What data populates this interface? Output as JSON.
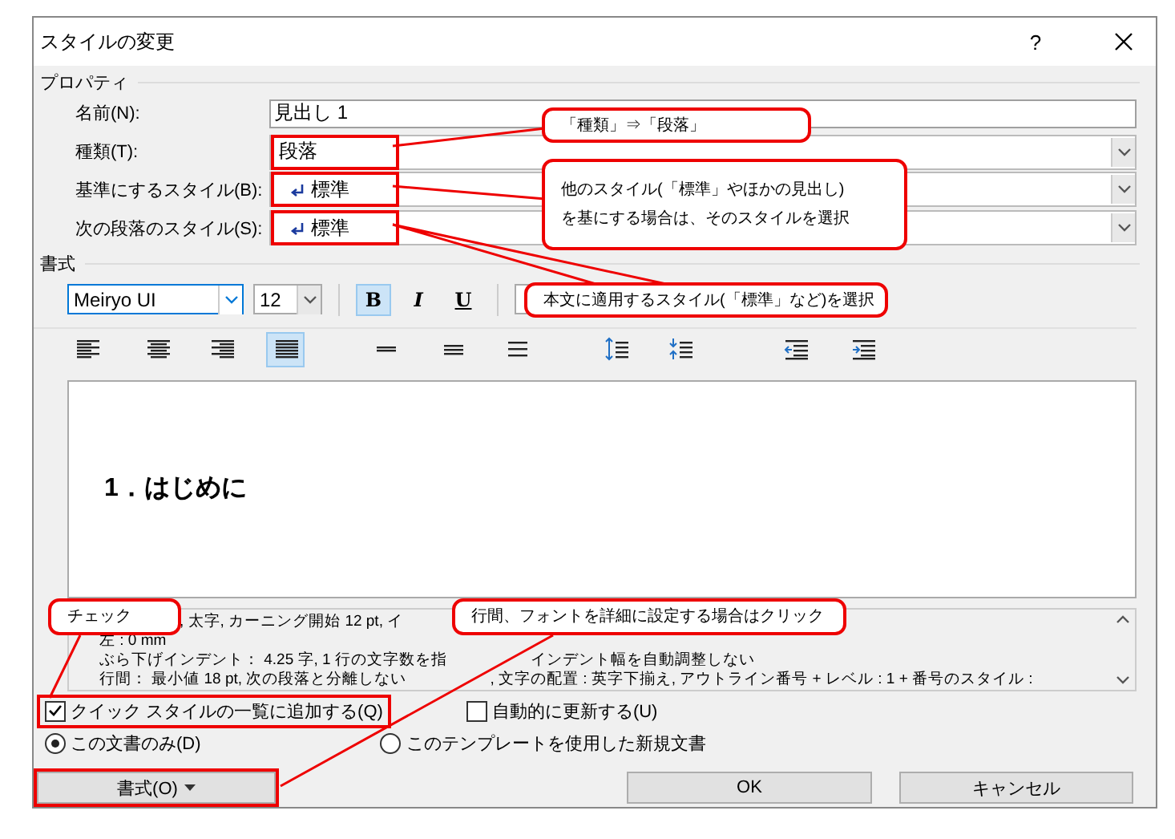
{
  "window": {
    "title": "スタイルの変更",
    "help": "?"
  },
  "properties": {
    "heading": "プロパティ",
    "fields": [
      {
        "label": "名前(N):",
        "value": "見出し 1",
        "kind": "text",
        "highlighted": false
      },
      {
        "label": "種類(T):",
        "value": "段落",
        "kind": "select",
        "highlighted": true
      },
      {
        "label": "基準にするスタイル(B):",
        "value": "標準",
        "kind": "style-select",
        "highlighted": true
      },
      {
        "label": "次の段落のスタイル(S):",
        "value": "標準",
        "kind": "style-select",
        "highlighted": true
      }
    ]
  },
  "format": {
    "heading": "書式",
    "font": "Meiryo UI",
    "size": "12",
    "styles": [
      {
        "label": "B",
        "kind": "bold",
        "selected": true
      },
      {
        "label": "I",
        "kind": "italic",
        "selected": false
      },
      {
        "label": "U",
        "kind": "underline",
        "selected": false
      }
    ],
    "paragraph_tools": [
      {
        "kind": "align-left",
        "selected": false
      },
      {
        "kind": "align-center",
        "selected": false
      },
      {
        "kind": "align-right",
        "selected": false
      },
      {
        "kind": "justify",
        "selected": true
      },
      {
        "kind": "single",
        "selected": false
      },
      {
        "kind": "one-half",
        "selected": false
      },
      {
        "kind": "double",
        "selected": false
      },
      {
        "kind": "space-more",
        "selected": false
      },
      {
        "kind": "space-less",
        "selected": false
      },
      {
        "kind": "outdent",
        "selected": false
      },
      {
        "kind": "indent",
        "selected": false
      }
    ]
  },
  "preview": {
    "text": "1．はじめに"
  },
  "description": {
    "lines": [
      [
        ", 太字, カーニング開始 12 pt, イ"
      ],
      [
        "左 : 0 mm"
      ],
      [
        "ぶら下げインデント： 4.25 字, 1 行の文字数を指",
        "インデント幅を自動調整しない"
      ],
      [
        "行間： 最小値 18 pt, 次の段落と分離しない",
        ", 文字の配置 : 英字下揃え, アウトライン番号 + レベル : 1 + 番号のスタイル :"
      ]
    ]
  },
  "checkboxes": [
    {
      "label": "クイック スタイルの一覧に追加する(Q)",
      "checked": true,
      "highlighted": true
    },
    {
      "label": "自動的に更新する(U)",
      "checked": false,
      "highlighted": false
    }
  ],
  "radios": [
    {
      "label": "この文書のみ(D)",
      "selected": true
    },
    {
      "label": "このテンプレートを使用した新規文書",
      "selected": false
    }
  ],
  "buttons": [
    {
      "kind": "format",
      "label": "書式(O)",
      "highlighted": true
    },
    {
      "kind": "ok",
      "label": "OK",
      "highlighted": false
    },
    {
      "kind": "cancel",
      "label": "キャンセル",
      "highlighted": false
    }
  ],
  "callouts": [
    {
      "lines": [
        "「種類」⇒「段落」"
      ]
    },
    {
      "lines": [
        "他のスタイル(「標準」やほかの見出し)",
        "を基にする場合は、そのスタイルを選択"
      ]
    },
    {
      "lines": [
        "本文に適用するスタイル(「標準」など)を選択"
      ]
    },
    {
      "lines": [
        "チェック"
      ]
    },
    {
      "lines": [
        "行間、フォントを詳細に設定する場合はクリック"
      ]
    }
  ]
}
